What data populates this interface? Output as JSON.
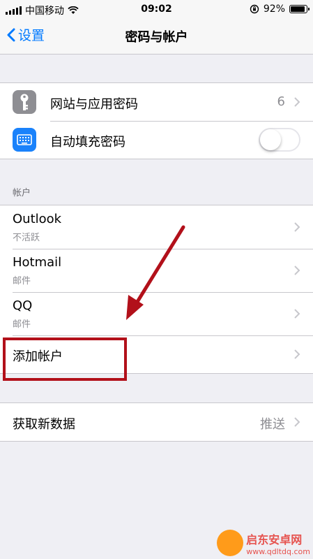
{
  "status_bar": {
    "carrier": "中国移动",
    "time": "09:02",
    "battery": "92%",
    "battery_level": 0.92
  },
  "nav": {
    "back_label": "设置",
    "title": "密码与帐户"
  },
  "passwords_group": {
    "website_passwords": {
      "label": "网站与应用密码",
      "value": "6",
      "icon": "key-icon"
    },
    "autofill": {
      "label": "自动填充密码",
      "enabled": false,
      "icon": "keyboard-icon"
    }
  },
  "accounts_section": {
    "header": "帐户",
    "items": [
      {
        "name": "Outlook",
        "detail": "不活跃"
      },
      {
        "name": "Hotmail",
        "detail": "邮件"
      },
      {
        "name": "QQ",
        "detail": "邮件"
      }
    ],
    "add_account": "添加帐户"
  },
  "fetch_group": {
    "label": "获取新数据",
    "value": "推送"
  },
  "annotation": {
    "color": "#b2101a"
  },
  "watermark": {
    "name": "启东安卓网",
    "url": "www.qdltdq.com"
  },
  "colors": {
    "accent": "#007aff",
    "background": "#efeff4"
  }
}
